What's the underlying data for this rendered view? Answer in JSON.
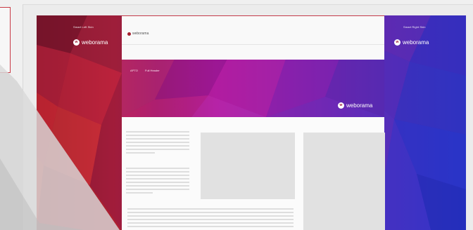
{
  "app": {
    "brand": "weborama"
  },
  "skins": {
    "left_label": "Smart Left Skin",
    "right_label": "Smart Right Skin"
  },
  "header": {
    "links": [
      "APTO",
      "Full Header"
    ]
  },
  "logos": {
    "left": "weborama",
    "right": "weborama",
    "center": "weborama",
    "top": "weborama"
  },
  "colors": {
    "accent": "#c43b4a",
    "purple": "#8b1fa6",
    "blue": "#2e34c2"
  }
}
